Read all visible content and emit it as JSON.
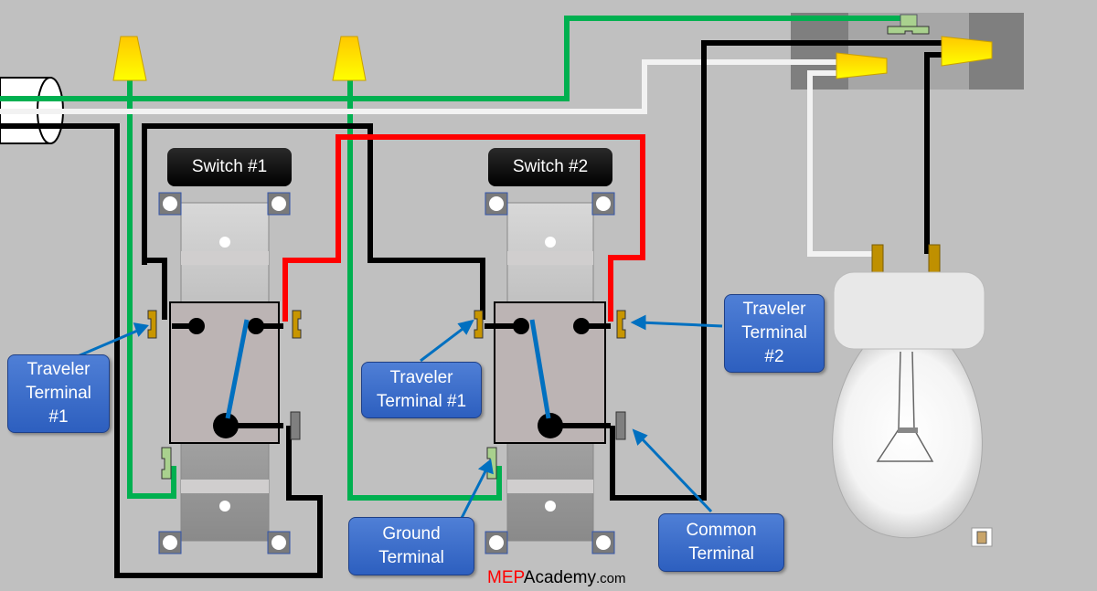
{
  "switches": [
    {
      "title": "Switch #1"
    },
    {
      "title": "Switch #2"
    }
  ],
  "labels": {
    "traveler1_left": [
      "Traveler",
      "Terminal",
      "#1"
    ],
    "traveler1_mid": [
      "Traveler",
      "Terminal #1"
    ],
    "traveler2": [
      "Traveler",
      "Terminal",
      "#2"
    ],
    "ground": [
      "Ground",
      "Terminal"
    ],
    "common": [
      "Common",
      "Terminal"
    ]
  },
  "logo": {
    "part1": "MEP",
    "part2": "Academy",
    "part3": ".com"
  },
  "colors": {
    "ground_wire": "#00b050",
    "neutral_wire": "#f2f2f2",
    "hot_wire": "#000000",
    "traveler_wire": "#ff0000",
    "label_bg": "#3366cc",
    "wire_nut": "#ffd800",
    "switch_lever": "#0070c0"
  },
  "icons": [
    "wire-nut-icon",
    "light-bulb-icon",
    "terminal-screw-icon",
    "paste-icon"
  ]
}
